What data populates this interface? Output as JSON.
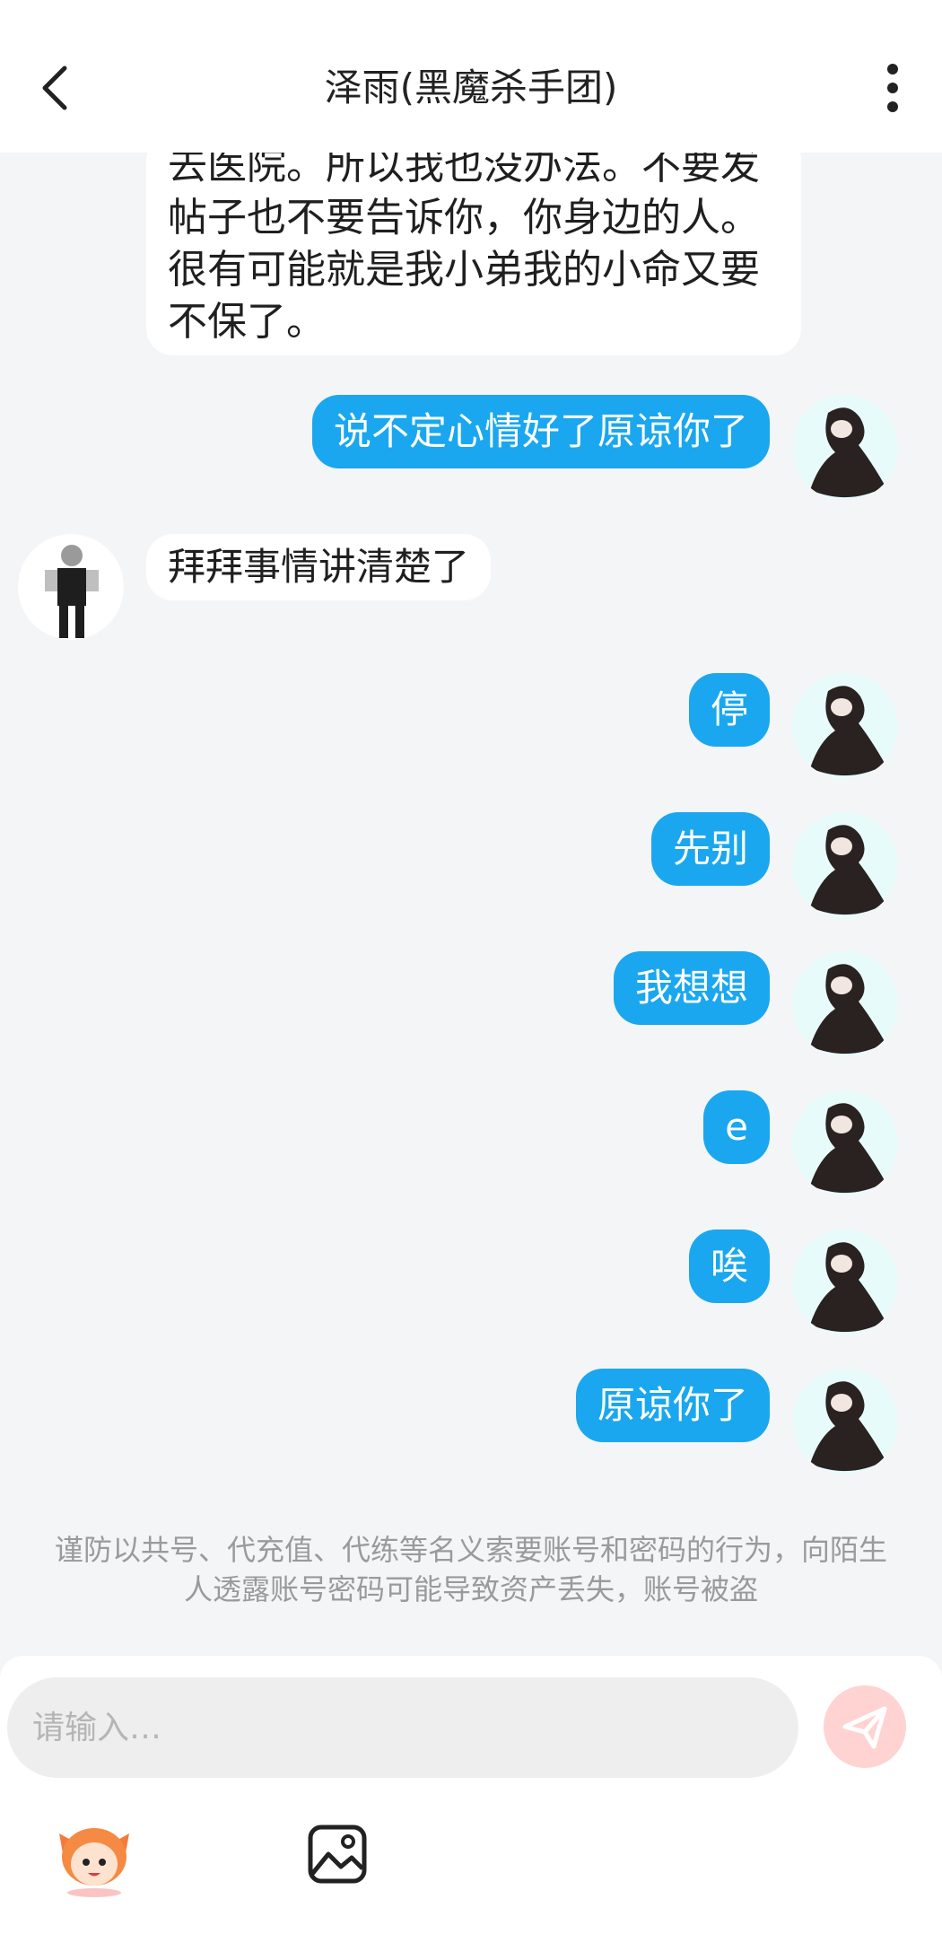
{
  "header": {
    "title": "泽雨(黑魔杀手团)",
    "back_icon": "chevron-left-icon",
    "more_icon": "more-vertical-icon"
  },
  "messages": [
    {
      "side": "in",
      "text": "去医院。所以我也没办法。不要发帖子也不要告诉你，你身边的人。很有可能就是我小弟我的小命又要不保了。"
    },
    {
      "side": "out",
      "text": "说不定心情好了原谅你了"
    },
    {
      "side": "in",
      "text": "拜拜事情讲清楚了"
    },
    {
      "side": "out",
      "text": "停"
    },
    {
      "side": "out",
      "text": "先别"
    },
    {
      "side": "out",
      "text": "我想想"
    },
    {
      "side": "out",
      "text": "e"
    },
    {
      "side": "out",
      "text": "唉"
    },
    {
      "side": "out",
      "text": "原谅你了"
    }
  ],
  "notice": "谨防以共号、代充值、代练等名义索要账号和密码的行为，向陌生人透露账号密码可能导致资产丢失，账号被盗",
  "composer": {
    "placeholder": "请输入…",
    "send_icon": "paper-plane-icon",
    "emoji_icon": "mascot-emoji-icon",
    "image_icon": "image-icon"
  },
  "colors": {
    "outgoing_bubble": "#1aa7ef",
    "incoming_bubble": "#ffffff",
    "background": "#f4f5f7",
    "send_button": "#ffd3d1"
  }
}
